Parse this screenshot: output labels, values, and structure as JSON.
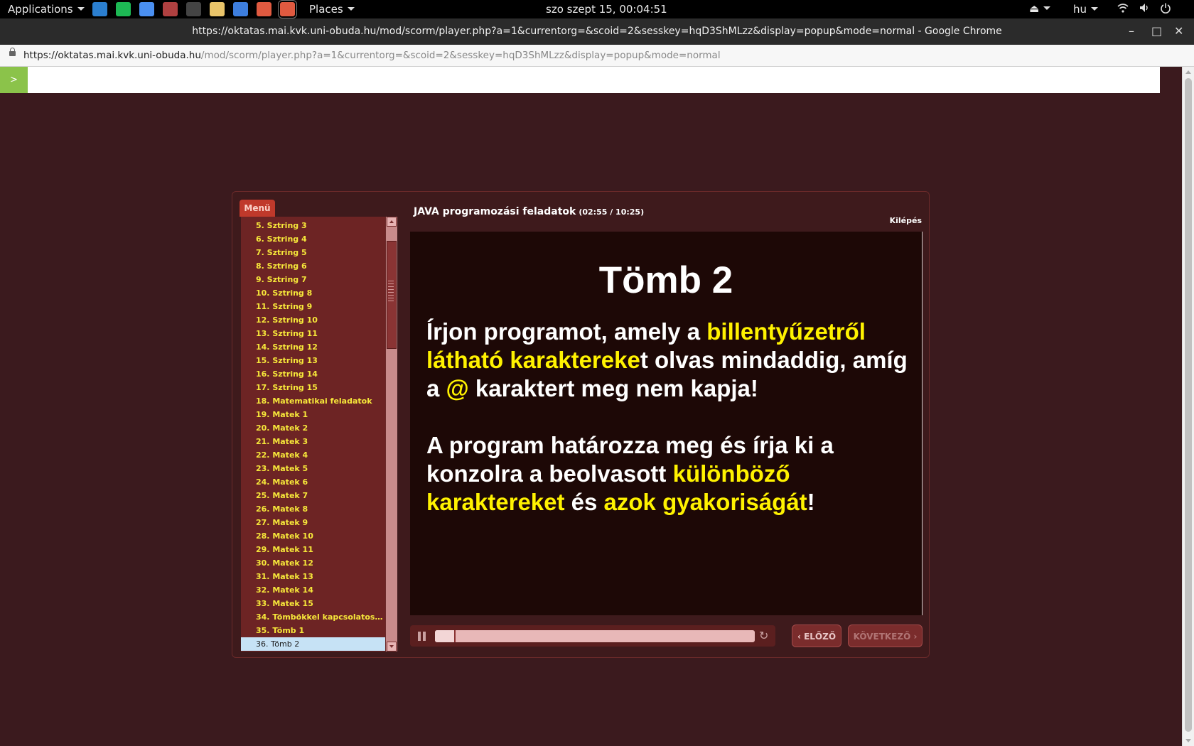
{
  "topbar": {
    "applications": "Applications",
    "places": "Places",
    "clock": "szo szept 15, 00:04:51",
    "language": "hu",
    "launchers": [
      {
        "name": "desktop-icon",
        "color": "#2b7fd0"
      },
      {
        "name": "spotify-icon",
        "color": "#1db954"
      },
      {
        "name": "chromium-icon",
        "color": "#4a8ff0"
      },
      {
        "name": "app-icon",
        "color": "#b04040"
      },
      {
        "name": "terminal-icon",
        "color": "#444"
      },
      {
        "name": "text-editor-icon",
        "color": "#e9c46a"
      },
      {
        "name": "system-monitor-icon",
        "color": "#3d7ede"
      },
      {
        "name": "chrome-icon",
        "color": "#e05a40"
      },
      {
        "name": "chrome-active-icon",
        "color": "#e05a40"
      }
    ]
  },
  "window": {
    "title": "https://oktatas.mai.kvk.uni-obuda.hu/mod/scorm/player.php?a=1&currentorg=&scoid=2&sesskey=hqD3ShMLzz&display=popup&mode=normal - Google Chrome",
    "minimize": "–",
    "maximize": "□",
    "close": "✕"
  },
  "address": {
    "host": "https://oktatas.mai.kvk.uni-obuda.hu",
    "path": "/mod/scorm/player.php?a=1&currentorg=&scoid=2&sesskey=hqD3ShMLzz&display=popup&mode=normal"
  },
  "page": {
    "toggle_label": ">"
  },
  "player": {
    "menu_tab": "Menü",
    "course_title": "JAVA programozási feladatok",
    "course_time": "(02:55 / 10:25)",
    "exit": "Kilépés",
    "progress_fraction": 0.06,
    "prev_label": "ELŐZŐ",
    "next_label": "KÖVETKEZŐ",
    "menu_items": [
      "5. Sztring 3",
      "6. Sztring  4",
      "7. Sztring 5",
      "8. Sztring 6",
      "9. Sztring 7",
      "10. Sztring 8",
      "11. Sztring 9",
      "12. Sztring 10",
      "13. Sztring 11",
      "14. Sztring 12",
      "15. Sztring 13",
      "16. Sztring 14",
      "17. Sztring 15",
      "18. Matematikai feladatok",
      "19. Matek 1",
      "20. Matek 2",
      "21. Matek 3",
      "22. Matek 4",
      "23. Matek 5",
      "24. Matek 6",
      "25. Matek 7",
      "26. Matek 8",
      "27. Matek 9",
      "28. Matek 10",
      "29. Matek 11",
      "30. Matek 12",
      "31. Matek 13",
      "32. Matek 14",
      "33. Matek 15",
      "34. Tömbökkel kapcsolatos f...",
      "35. Tömb 1",
      "36. Tömb 2"
    ],
    "selected_index": 31
  },
  "slide": {
    "title": "Tömb 2",
    "p1": [
      {
        "text": "Írjon programot, amely a ",
        "hl": false
      },
      {
        "text": "billentyűzetről látható karaktereke",
        "hl": true
      },
      {
        "text": "t olvas mindaddig, amíg a ",
        "hl": false
      },
      {
        "text": "@",
        "hl": true
      },
      {
        "text": " karaktert meg nem kapja!",
        "hl": false
      }
    ],
    "p2": [
      {
        "text": "A program határozza meg és írja ki a konzolra a beolvasott ",
        "hl": false
      },
      {
        "text": "különböző karaktereket",
        "hl": true
      },
      {
        "text": " és ",
        "hl": false
      },
      {
        "text": "azok gyakoriságát",
        "hl": true
      },
      {
        "text": "!",
        "hl": false
      }
    ],
    "highlight_color": "#fff200"
  }
}
